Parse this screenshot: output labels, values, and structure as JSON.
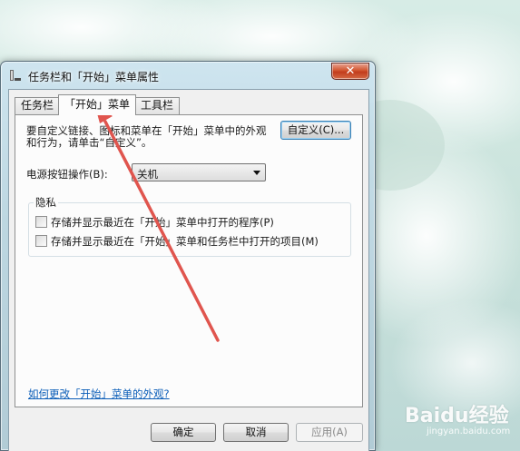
{
  "window": {
    "title": "任务栏和「开始」菜单属性",
    "close_glyph": "✕"
  },
  "tabs": [
    {
      "label": "任务栏",
      "active": false
    },
    {
      "label": "「开始」菜单",
      "active": true
    },
    {
      "label": "工具栏",
      "active": false
    }
  ],
  "start_menu": {
    "intro_text": "要自定义链接、图标和菜单在「开始」菜单中的外观和行为，请单击“自定义”。",
    "customize_button": "自定义(C)...",
    "power_label": "电源按钮操作(B):",
    "power_value": "关机",
    "privacy": {
      "group_label": "隐私",
      "options": [
        {
          "label": "存储并显示最近在「开始」菜单中打开的程序(P)",
          "checked": false
        },
        {
          "label": "存储并显示最近在「开始」菜单和任务栏中打开的项目(M)",
          "checked": false
        }
      ]
    },
    "help_link": "如何更改「开始」菜单的外观?"
  },
  "footer": {
    "ok": "确定",
    "cancel": "取消",
    "apply": "应用(A)"
  },
  "watermark": {
    "brand": "Baidu经验",
    "url": "jingyan.baidu.com"
  },
  "colors": {
    "link": "#0a5db8",
    "annotation_arrow": "#e0554e",
    "close_button": "#c94524"
  }
}
